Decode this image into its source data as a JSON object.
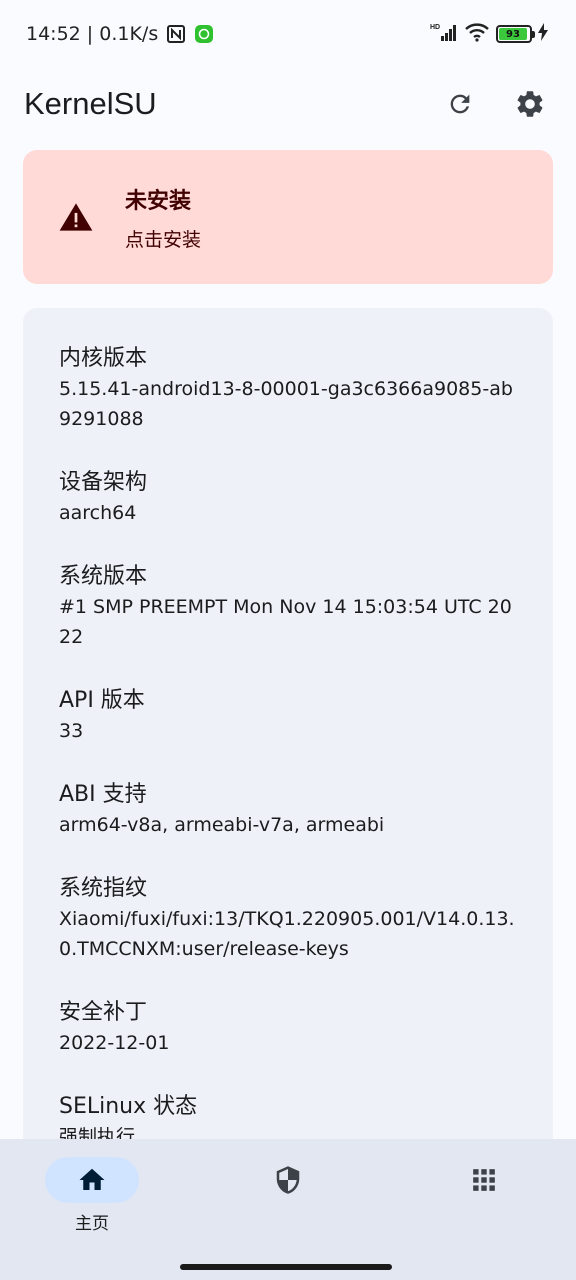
{
  "status_bar": {
    "time_speed": "14:52 | 0.1K/s",
    "battery": "93",
    "network": "HD"
  },
  "app_bar": {
    "title": "KernelSU",
    "refresh_icon": "refresh-icon",
    "settings_icon": "gear-icon"
  },
  "warning": {
    "title": "未安装",
    "subtitle": "点击安装",
    "icon": "warning-icon"
  },
  "info": [
    {
      "label": "内核版本",
      "value": "5.15.41-android13-8-00001-ga3c6366a9085-ab9291088"
    },
    {
      "label": "设备架构",
      "value": "aarch64"
    },
    {
      "label": "系统版本",
      "value": "#1 SMP PREEMPT Mon Nov 14 15:03:54 UTC 2022"
    },
    {
      "label": "API 版本",
      "value": "33"
    },
    {
      "label": "ABI 支持",
      "value": "arm64-v8a, armeabi-v7a, armeabi"
    },
    {
      "label": "系统指纹",
      "value": "Xiaomi/fuxi/fuxi:13/TKQ1.220905.001/V14.0.13.0.TMCCNXM:user/release-keys"
    },
    {
      "label": "安全补丁",
      "value": "2022-12-01"
    },
    {
      "label": "SELinux 状态",
      "value": "强制执行"
    }
  ],
  "bottom_nav": {
    "home_label": "主页",
    "home_icon": "home-icon",
    "superuser_icon": "shield-icon",
    "modules_icon": "grid-icon"
  },
  "colors": {
    "warning_bg": "#ffdad6",
    "card_bg": "#eff1f8",
    "nav_bg": "#e2e7f1",
    "nav_active": "#d1e4ff"
  }
}
